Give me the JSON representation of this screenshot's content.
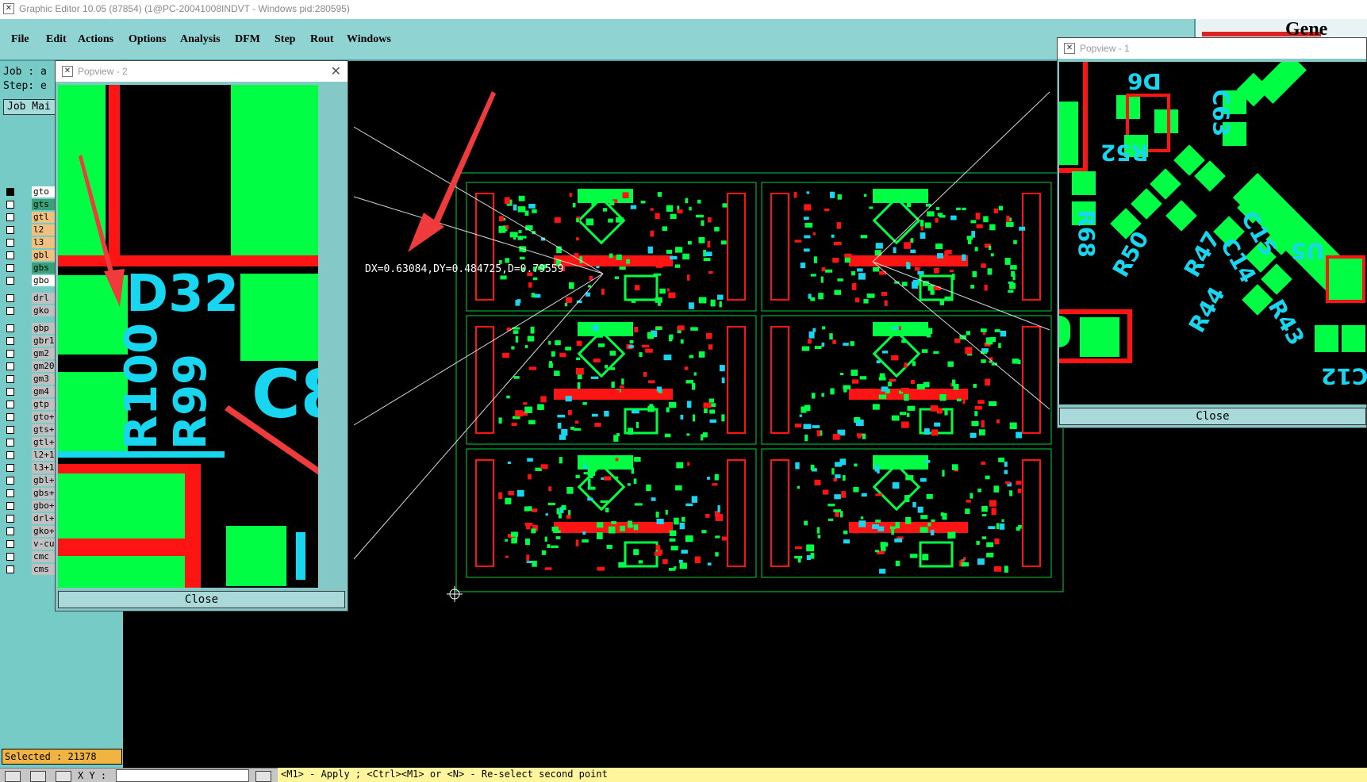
{
  "window": {
    "title": "Graphic Editor 10.05 (87854) (1@PC-20041008INDVT - Windows  pid:280595)"
  },
  "menu": [
    "File",
    "Edit",
    "Actions",
    "Options",
    "Analysis",
    "DFM",
    "Step",
    "Rout",
    "Windows"
  ],
  "brand": {
    "text": "Gene"
  },
  "left_panel": {
    "job_label": "Job : a",
    "step_label": "Step: e",
    "job_mgr_button": "Job Mai",
    "layers": [
      {
        "name": "gto",
        "color": "#ffffff"
      },
      {
        "name": "gts",
        "color": "#3aa07a"
      },
      {
        "name": "gtl",
        "color": "#f0c080"
      },
      {
        "name": "l2",
        "color": "#f0c080"
      },
      {
        "name": "l3",
        "color": "#f0c080"
      },
      {
        "name": "gbl",
        "color": "#f0c080"
      },
      {
        "name": "gbs",
        "color": "#3aa07a"
      },
      {
        "name": "gbo",
        "color": "#ffffff"
      },
      {
        "name": "drl",
        "color": "#c0c0c0"
      },
      {
        "name": "gko",
        "color": "#c0c0c0"
      },
      {
        "name": "gbp",
        "color": "#c0c0c0"
      },
      {
        "name": "gbr1",
        "color": "#c0c0c0"
      },
      {
        "name": "gm2",
        "color": "#c0c0c0"
      },
      {
        "name": "gm20",
        "color": "#c0c0c0"
      },
      {
        "name": "gm3",
        "color": "#c0c0c0"
      },
      {
        "name": "gm4",
        "color": "#c0c0c0"
      },
      {
        "name": "gtp",
        "color": "#c0c0c0"
      },
      {
        "name": "gto+",
        "color": "#c0c0c0"
      },
      {
        "name": "gts+",
        "color": "#c0c0c0"
      },
      {
        "name": "gtl+",
        "color": "#c0c0c0"
      },
      {
        "name": "l2+1",
        "color": "#c0c0c0"
      },
      {
        "name": "l3+1",
        "color": "#c0c0c0"
      },
      {
        "name": "gbl+",
        "color": "#c0c0c0"
      },
      {
        "name": "gbs+",
        "color": "#c0c0c0"
      },
      {
        "name": "gbo+",
        "color": "#c0c0c0"
      },
      {
        "name": "drl+",
        "color": "#c0c0c0"
      },
      {
        "name": "gko+",
        "color": "#c0c0c0"
      },
      {
        "name": "v-cu",
        "color": "#c0c0c0"
      },
      {
        "name": "cmc",
        "color": "#c0c0c0"
      },
      {
        "name": "cms",
        "color": "#c0c0c0"
      }
    ],
    "selected": "Selected : 21378"
  },
  "popview2": {
    "title": "Popview - 2",
    "labels": {
      "d32": "D32",
      "r100": "R100",
      "r99": "R99",
      "c8": "C8"
    },
    "close": "Close"
  },
  "popview1": {
    "title": "Popview - 1",
    "labels": [
      "D6",
      "C63",
      "R52",
      "R68",
      "C15",
      "C14",
      "R50",
      "R47",
      "R43",
      "R44",
      "U5",
      "C12"
    ],
    "close": "Close"
  },
  "canvas": {
    "measure": "DX=0.63084,DY=0.484725,D=0.79559"
  },
  "status": {
    "xy_label": "X Y :",
    "prompt": "<M1> - Apply  ; <Ctrl><M1> or <N> - Re-select second point"
  },
  "colors": {
    "menubar": "#8fd3d3",
    "panel": "#76cbc6",
    "pad": "#00ff44",
    "trace": "#ff1414",
    "silk": "#19d6f0",
    "arrow": "#ef3b3b"
  }
}
